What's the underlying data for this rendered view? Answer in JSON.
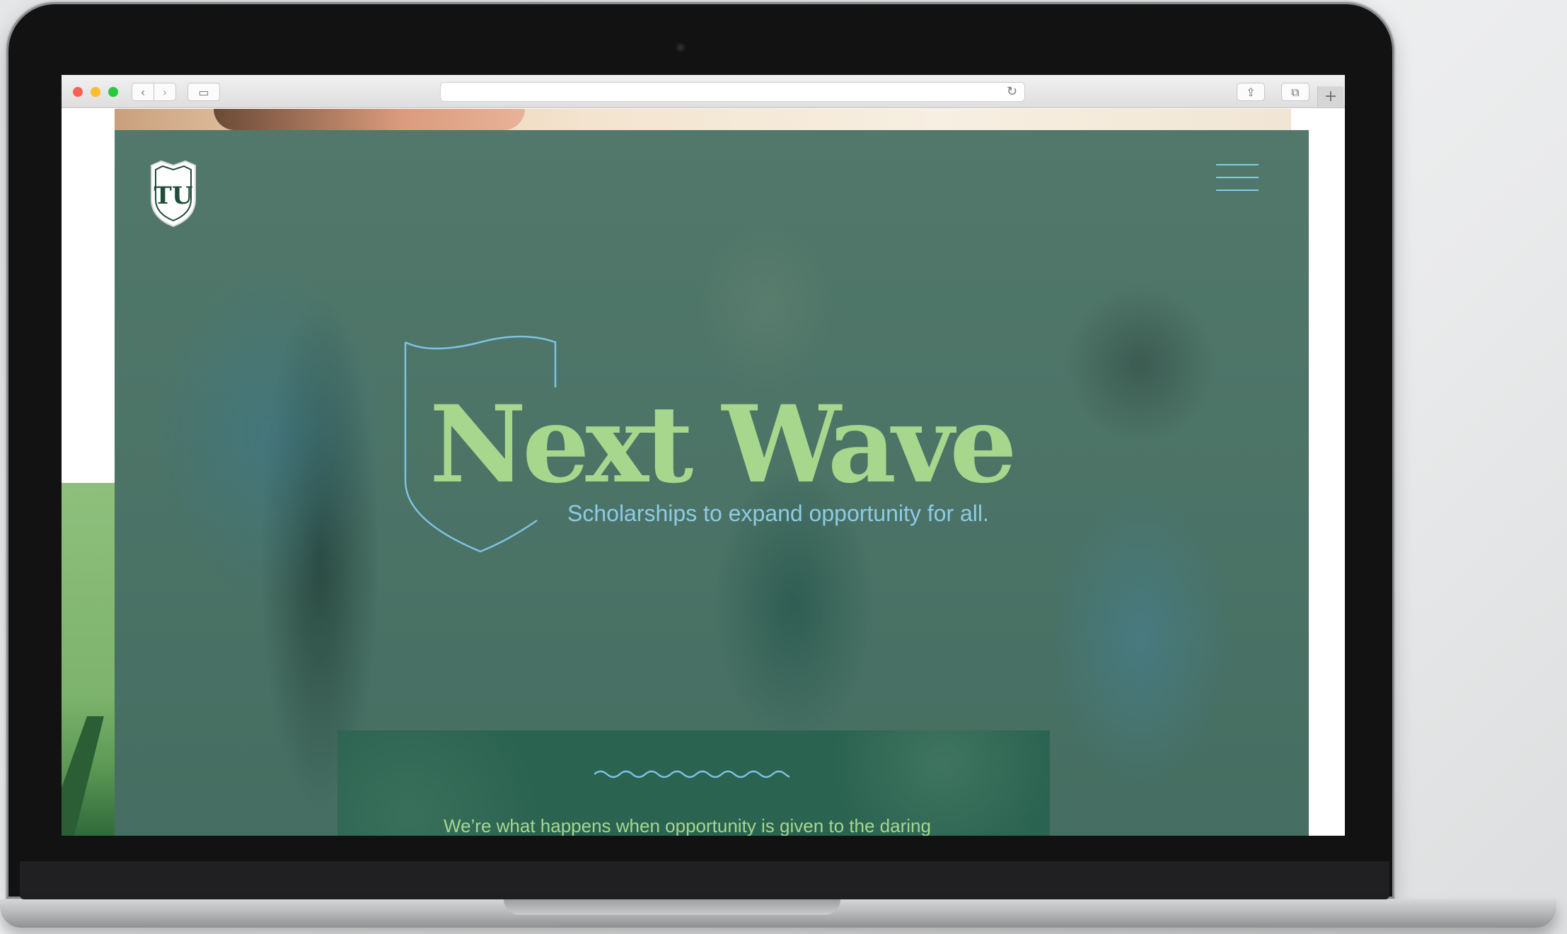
{
  "browser": {
    "back_icon": "‹",
    "forward_icon": "›",
    "sidebar_icon": "▭",
    "reload_icon": "↻",
    "share_icon": "⇪",
    "tabs_icon": "⧉",
    "new_tab_icon": "+"
  },
  "hero": {
    "title": "Next Wave",
    "subtitle": "Scholarships to expand opportunity for all.",
    "intro_text": "We’re what happens when opportunity is given to the daring",
    "logo_monogram": "TU"
  },
  "colors": {
    "title_green": "#a7d68d",
    "subtitle_blue": "#8ecbe6",
    "hero_overlay": "#4f786b",
    "panel_green": "#2b6351"
  }
}
